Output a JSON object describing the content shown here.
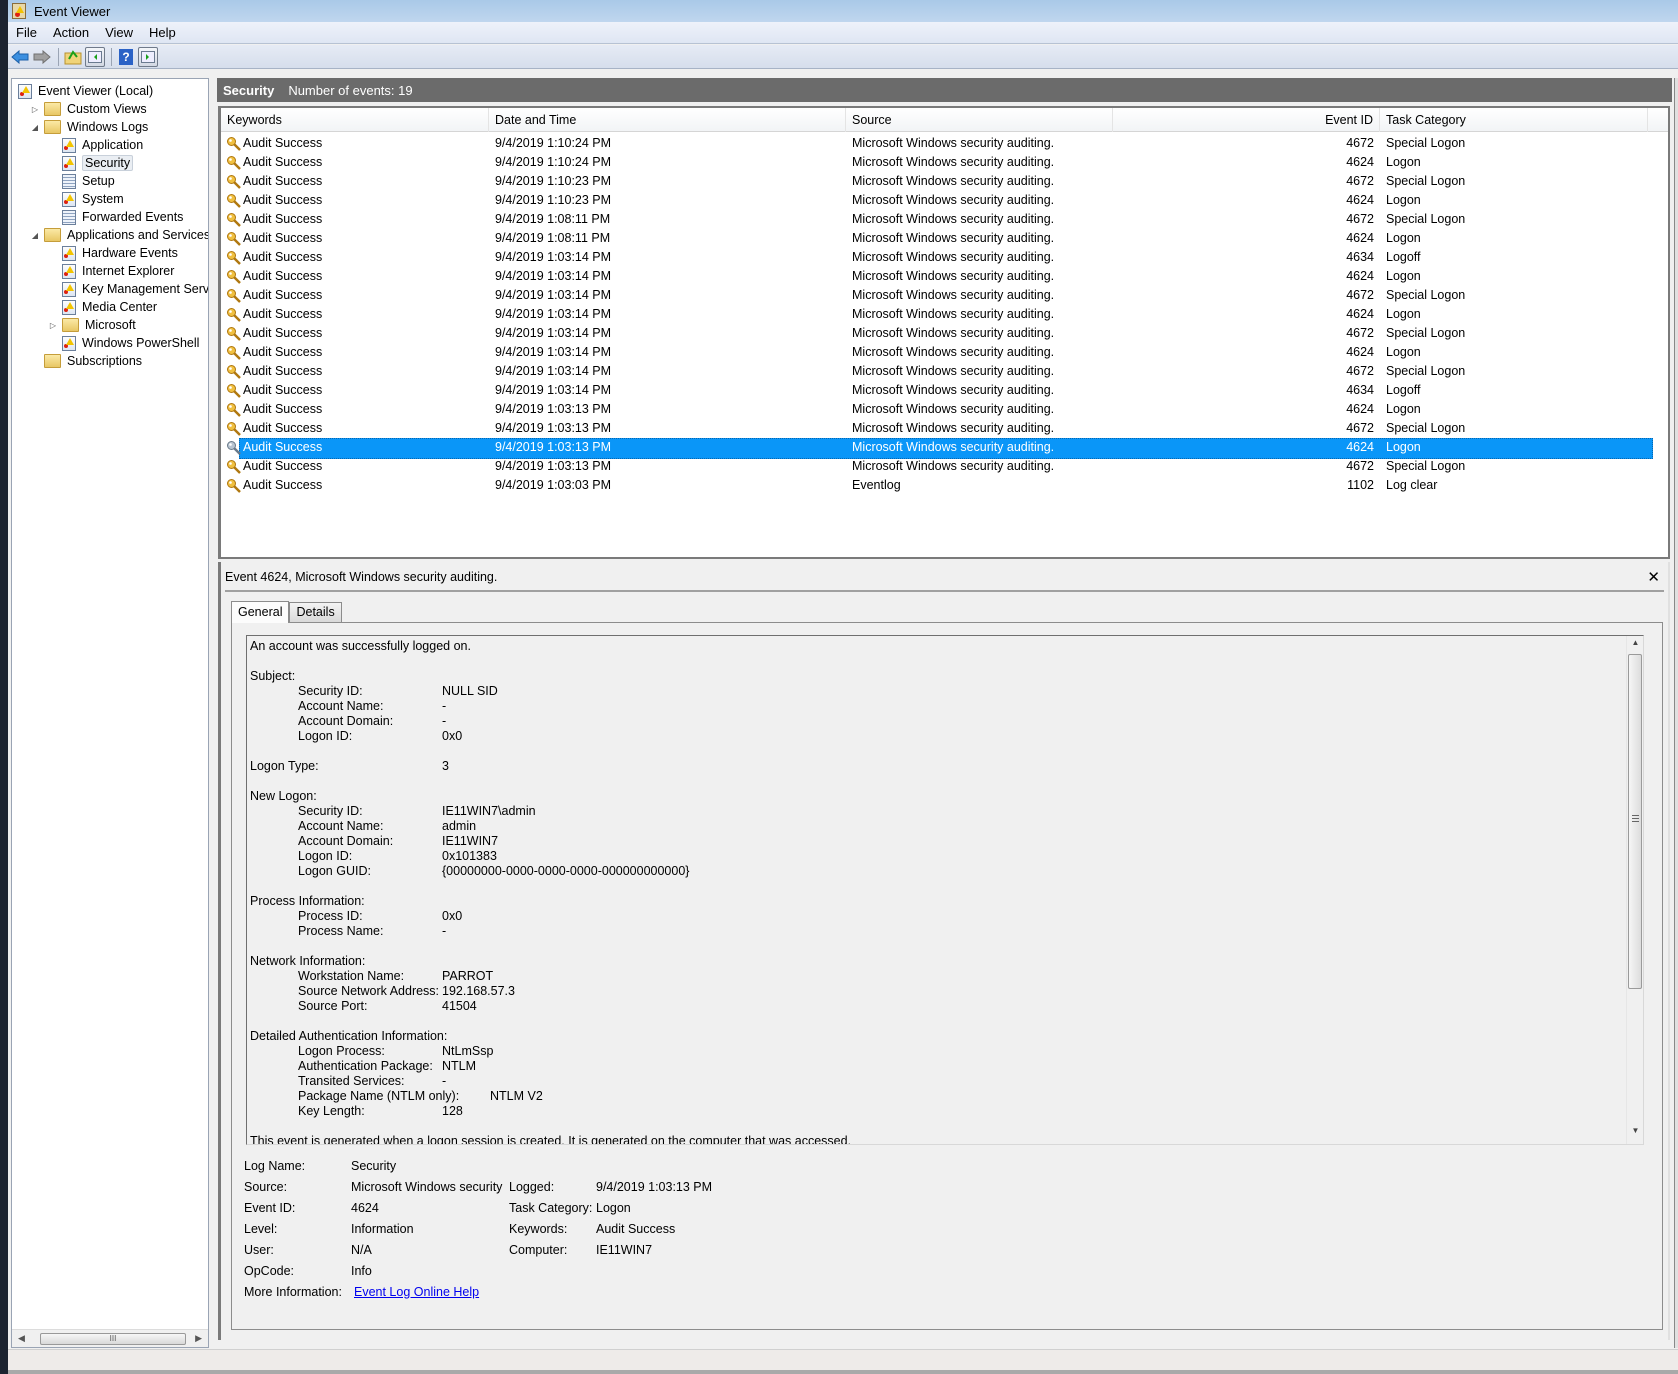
{
  "window": {
    "title": "Event Viewer",
    "menu": [
      "File",
      "Action",
      "View",
      "Help"
    ],
    "toolbar": [
      {
        "name": "back-icon"
      },
      {
        "name": "forward-icon"
      },
      {
        "name": "up-folder-icon"
      },
      {
        "name": "show-hide-console-tree-icon"
      },
      {
        "name": "help-icon"
      },
      {
        "name": "show-hide-action-pane-icon"
      }
    ]
  },
  "tree": {
    "items": [
      {
        "label": "Event Viewer (Local)",
        "icon": "event-viewer-icon",
        "level": 0,
        "expander": ""
      },
      {
        "label": "Custom Views",
        "icon": "folder-filter-icon",
        "level": 1,
        "expander": "collapsed"
      },
      {
        "label": "Windows Logs",
        "icon": "folder-windows-icon",
        "level": 1,
        "expander": "expanded"
      },
      {
        "label": "Application",
        "icon": "log-icon",
        "level": 2,
        "expander": ""
      },
      {
        "label": "Security",
        "icon": "log-icon",
        "level": 2,
        "expander": "",
        "selected": true
      },
      {
        "label": "Setup",
        "icon": "log-plain-icon",
        "level": 2,
        "expander": ""
      },
      {
        "label": "System",
        "icon": "log-icon",
        "level": 2,
        "expander": ""
      },
      {
        "label": "Forwarded Events",
        "icon": "log-plain-icon",
        "level": 2,
        "expander": ""
      },
      {
        "label": "Applications and Services Logs",
        "icon": "folder-icon",
        "level": 1,
        "expander": "expanded"
      },
      {
        "label": "Hardware Events",
        "icon": "log-icon",
        "level": 2,
        "expander": ""
      },
      {
        "label": "Internet Explorer",
        "icon": "log-icon",
        "level": 2,
        "expander": ""
      },
      {
        "label": "Key Management Service",
        "icon": "log-icon",
        "level": 2,
        "expander": ""
      },
      {
        "label": "Media Center",
        "icon": "log-icon",
        "level": 2,
        "expander": ""
      },
      {
        "label": "Microsoft",
        "icon": "folder-icon",
        "level": 2,
        "expander": "collapsed"
      },
      {
        "label": "Windows PowerShell",
        "icon": "log-icon",
        "level": 2,
        "expander": ""
      },
      {
        "label": "Subscriptions",
        "icon": "subscriptions-icon",
        "level": 1,
        "expander": ""
      }
    ],
    "hscroll_grip": "III"
  },
  "log_header": {
    "title": "Security",
    "count_label": "Number of events: 19"
  },
  "grid": {
    "columns": [
      "Keywords",
      "Date and Time",
      "Source",
      "Event ID",
      "Task Category"
    ],
    "rows": [
      {
        "keywords": "Audit Success",
        "date": "9/4/2019 1:10:24 PM",
        "source": "Microsoft Windows security auditing.",
        "event_id": "4672",
        "category": "Special Logon"
      },
      {
        "keywords": "Audit Success",
        "date": "9/4/2019 1:10:24 PM",
        "source": "Microsoft Windows security auditing.",
        "event_id": "4624",
        "category": "Logon"
      },
      {
        "keywords": "Audit Success",
        "date": "9/4/2019 1:10:23 PM",
        "source": "Microsoft Windows security auditing.",
        "event_id": "4672",
        "category": "Special Logon"
      },
      {
        "keywords": "Audit Success",
        "date": "9/4/2019 1:10:23 PM",
        "source": "Microsoft Windows security auditing.",
        "event_id": "4624",
        "category": "Logon"
      },
      {
        "keywords": "Audit Success",
        "date": "9/4/2019 1:08:11 PM",
        "source": "Microsoft Windows security auditing.",
        "event_id": "4672",
        "category": "Special Logon"
      },
      {
        "keywords": "Audit Success",
        "date": "9/4/2019 1:08:11 PM",
        "source": "Microsoft Windows security auditing.",
        "event_id": "4624",
        "category": "Logon"
      },
      {
        "keywords": "Audit Success",
        "date": "9/4/2019 1:03:14 PM",
        "source": "Microsoft Windows security auditing.",
        "event_id": "4634",
        "category": "Logoff"
      },
      {
        "keywords": "Audit Success",
        "date": "9/4/2019 1:03:14 PM",
        "source": "Microsoft Windows security auditing.",
        "event_id": "4624",
        "category": "Logon"
      },
      {
        "keywords": "Audit Success",
        "date": "9/4/2019 1:03:14 PM",
        "source": "Microsoft Windows security auditing.",
        "event_id": "4672",
        "category": "Special Logon"
      },
      {
        "keywords": "Audit Success",
        "date": "9/4/2019 1:03:14 PM",
        "source": "Microsoft Windows security auditing.",
        "event_id": "4624",
        "category": "Logon"
      },
      {
        "keywords": "Audit Success",
        "date": "9/4/2019 1:03:14 PM",
        "source": "Microsoft Windows security auditing.",
        "event_id": "4672",
        "category": "Special Logon"
      },
      {
        "keywords": "Audit Success",
        "date": "9/4/2019 1:03:14 PM",
        "source": "Microsoft Windows security auditing.",
        "event_id": "4624",
        "category": "Logon"
      },
      {
        "keywords": "Audit Success",
        "date": "9/4/2019 1:03:14 PM",
        "source": "Microsoft Windows security auditing.",
        "event_id": "4672",
        "category": "Special Logon"
      },
      {
        "keywords": "Audit Success",
        "date": "9/4/2019 1:03:14 PM",
        "source": "Microsoft Windows security auditing.",
        "event_id": "4634",
        "category": "Logoff"
      },
      {
        "keywords": "Audit Success",
        "date": "9/4/2019 1:03:13 PM",
        "source": "Microsoft Windows security auditing.",
        "event_id": "4624",
        "category": "Logon"
      },
      {
        "keywords": "Audit Success",
        "date": "9/4/2019 1:03:13 PM",
        "source": "Microsoft Windows security auditing.",
        "event_id": "4672",
        "category": "Special Logon"
      },
      {
        "keywords": "Audit Success",
        "date": "9/4/2019 1:03:13 PM",
        "source": "Microsoft Windows security auditing.",
        "event_id": "4624",
        "category": "Logon",
        "selected": true
      },
      {
        "keywords": "Audit Success",
        "date": "9/4/2019 1:03:13 PM",
        "source": "Microsoft Windows security auditing.",
        "event_id": "4672",
        "category": "Special Logon"
      },
      {
        "keywords": "Audit Success",
        "date": "9/4/2019 1:03:03 PM",
        "source": "Eventlog",
        "event_id": "1102",
        "category": "Log clear"
      }
    ],
    "selection_color": "#0a96f8"
  },
  "detail": {
    "title": "Event 4624, Microsoft Windows security auditing.",
    "tabs": [
      "General",
      "Details"
    ],
    "active_tab": "General",
    "description": [
      {
        "text": "An account was successfully logged on."
      },
      {
        "text": ""
      },
      {
        "text": "Subject:"
      },
      {
        "label": "Security ID:",
        "value": "NULL SID"
      },
      {
        "label": "Account Name:",
        "value": "-"
      },
      {
        "label": "Account Domain:",
        "value": "-"
      },
      {
        "label": "Logon ID:",
        "value": "0x0"
      },
      {
        "text": ""
      },
      {
        "text": "Logon Type:",
        "value0": "3"
      },
      {
        "text": ""
      },
      {
        "text": "New Logon:"
      },
      {
        "label": "Security ID:",
        "value": "IE11WIN7\\admin"
      },
      {
        "label": "Account Name:",
        "value": "admin"
      },
      {
        "label": "Account Domain:",
        "value": "IE11WIN7"
      },
      {
        "label": "Logon ID:",
        "value": "0x101383"
      },
      {
        "label": "Logon GUID:",
        "value": "{00000000-0000-0000-0000-000000000000}"
      },
      {
        "text": ""
      },
      {
        "text": "Process Information:"
      },
      {
        "label": "Process ID:",
        "value": "0x0"
      },
      {
        "label": "Process Name:",
        "value": "-"
      },
      {
        "text": ""
      },
      {
        "text": "Network Information:"
      },
      {
        "label": "Workstation Name:",
        "value": "PARROT"
      },
      {
        "label": "Source Network Address:",
        "value": "192.168.57.3"
      },
      {
        "label": "Source Port:",
        "value": "41504"
      },
      {
        "text": ""
      },
      {
        "text": "Detailed Authentication Information:"
      },
      {
        "label": "Logon Process:",
        "value": "NtLmSsp"
      },
      {
        "label": "Authentication Package:",
        "value": "NTLM"
      },
      {
        "label": "Transited Services:",
        "value": "-"
      },
      {
        "label": "Package Name (NTLM only):",
        "value": "NTLM V2",
        "wide": true
      },
      {
        "label": "Key Length:",
        "value": "128"
      },
      {
        "text": ""
      },
      {
        "text": "This event is generated when a logon session is created. It is generated on the computer that was accessed."
      }
    ],
    "properties": {
      "log_name_label": "Log Name:",
      "log_name": "Security",
      "source_label": "Source:",
      "source": "Microsoft Windows security",
      "logged_label": "Logged:",
      "logged": "9/4/2019 1:03:13 PM",
      "event_id_label": "Event ID:",
      "event_id": "4624",
      "task_category_label": "Task Category:",
      "task_category": "Logon",
      "level_label": "Level:",
      "level": "Information",
      "keywords_label": "Keywords:",
      "keywords": "Audit Success",
      "user_label": "User:",
      "user": "N/A",
      "computer_label": "Computer:",
      "computer": "IE11WIN7",
      "opcode_label": "OpCode:",
      "opcode": "Info",
      "more_info_label": "More Information:",
      "more_info_link": "Event Log Online Help"
    }
  }
}
